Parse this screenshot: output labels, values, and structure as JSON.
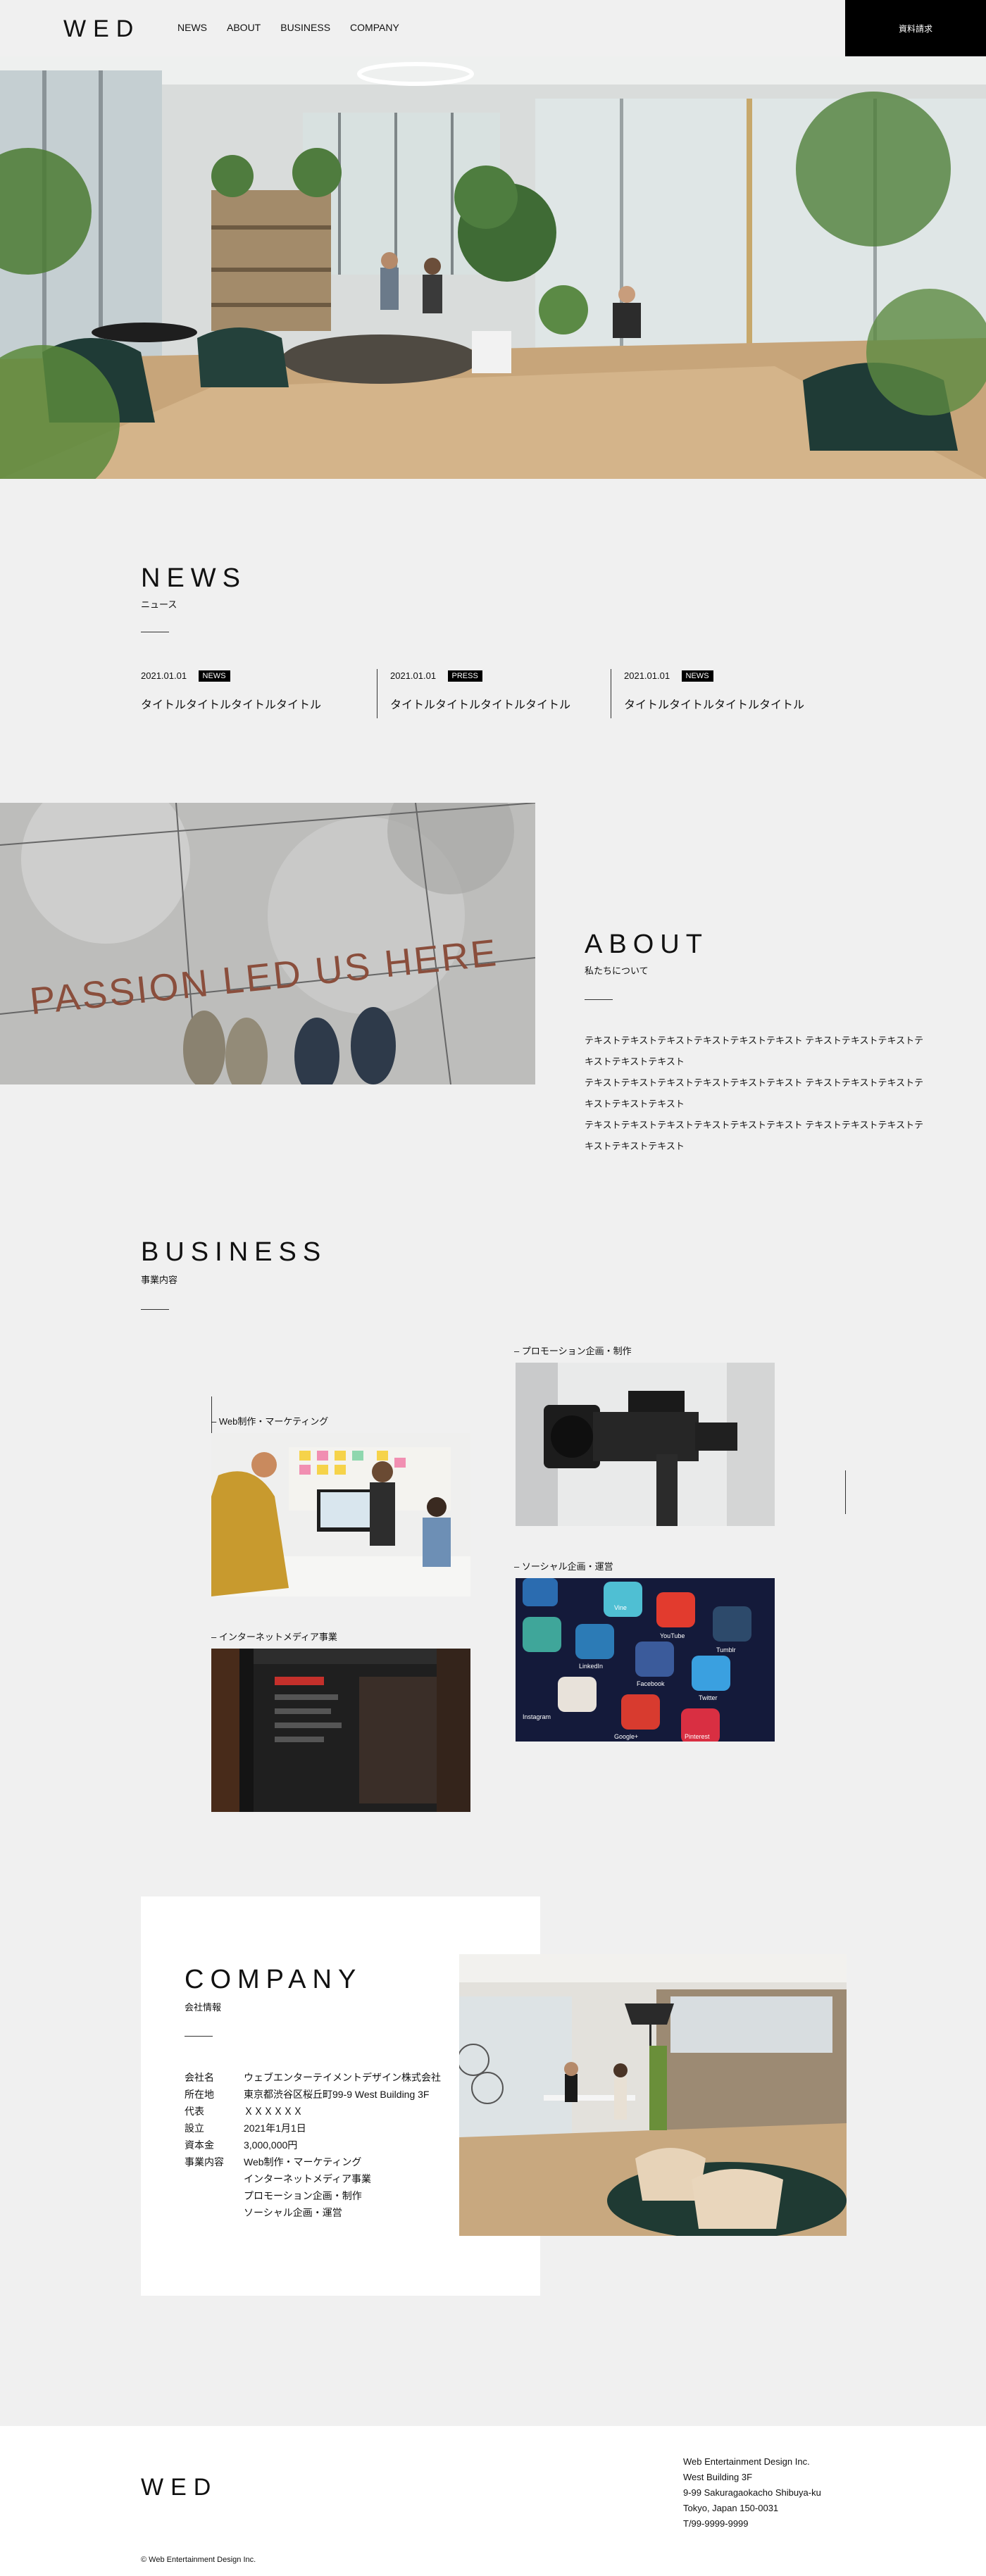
{
  "header": {
    "logo": "WED",
    "nav": [
      "NEWS",
      "ABOUT",
      "BUSINESS",
      "COMPANY"
    ],
    "cta": "資料請求"
  },
  "news": {
    "title": "NEWS",
    "subtitle": "ニュース",
    "items": [
      {
        "date": "2021.01.01",
        "tag": "NEWS",
        "title": "タイトルタイトルタイトルタイトル"
      },
      {
        "date": "2021.01.01",
        "tag": "PRESS",
        "title": "タイトルタイトルタイトルタイトル"
      },
      {
        "date": "2021.01.01",
        "tag": "NEWS",
        "title": "タイトルタイトルタイトルタイトル"
      }
    ]
  },
  "about": {
    "title": "ABOUT",
    "subtitle": "私たちについて",
    "image_text": "PASSION LED US HERE",
    "paragraphs": [
      "テキストテキストテキストテキストテキストテキスト テキストテキストテキストテキストテキストテキスト",
      "テキストテキストテキストテキストテキストテキスト テキストテキストテキストテキストテキストテキスト",
      "テキストテキストテキストテキストテキストテキスト テキストテキストテキストテキストテキストテキスト"
    ]
  },
  "business": {
    "title": "BUSINESS",
    "subtitle": "事業内容",
    "items": [
      {
        "label": "– プロモーション企画・制作"
      },
      {
        "label": "– Web制作・マーケティング"
      },
      {
        "label": "– ソーシャル企画・運営"
      },
      {
        "label": "– インターネットメディア事業"
      }
    ],
    "social_icons": [
      "Vine",
      "YouTube",
      "Tumblr",
      "LinkedIn",
      "Facebook",
      "Twitter",
      "Instagram",
      "Google+",
      "Pinterest"
    ]
  },
  "company": {
    "title": "COMPANY",
    "subtitle": "会社情報",
    "rows": [
      {
        "key": "会社名",
        "value": "ウェブエンターテイメントデザイン株式会社"
      },
      {
        "key": "所在地",
        "value": "東京都渋谷区桜丘町99-9 West Building 3F"
      },
      {
        "key": "代表",
        "value": "ＸＸＸＸＸＸ"
      },
      {
        "key": "設立",
        "value": "2021年1月1日"
      },
      {
        "key": "資本金",
        "value": "3,000,000円"
      },
      {
        "key": "事業内容",
        "value": "Web制作・マーケティング"
      },
      {
        "key": "",
        "value": "インターネットメディア事業"
      },
      {
        "key": "",
        "value": "プロモーション企画・制作"
      },
      {
        "key": "",
        "value": "ソーシャル企画・運営"
      }
    ]
  },
  "footer": {
    "logo": "WED",
    "address": [
      "Web Entertainment Design Inc.",
      "West Building 3F",
      "9-99 Sakuragaokacho Shibuya-ku",
      "Tokyo, Japan 150-0031",
      "T/99-9999-9999"
    ],
    "copyright": "© Web Entertainment Design Inc."
  },
  "colors": {
    "background": "#f0f0f0",
    "accent": "#000000",
    "white": "#ffffff"
  }
}
